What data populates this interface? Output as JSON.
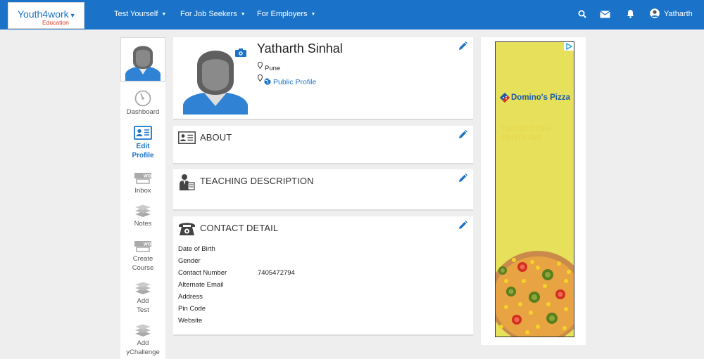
{
  "header": {
    "logo_main": "Youth4work",
    "logo_sub": "Education",
    "nav": [
      {
        "label": "Test Yourself"
      },
      {
        "label": "For Job Seekers"
      },
      {
        "label": "For Employers"
      }
    ],
    "user_name": "Yatharth",
    "icons": [
      "search-icon",
      "mail-icon",
      "bell-icon",
      "user-avatar-icon"
    ]
  },
  "sidebar": {
    "items": [
      {
        "label": "Dashboard",
        "icon": "gauge-icon"
      },
      {
        "label": "Edit Profile",
        "icon": "id-card-icon",
        "active": true
      },
      {
        "label": "Inbox",
        "icon": "inbox-icon"
      },
      {
        "label": "Notes",
        "icon": "books-icon"
      },
      {
        "label": "Create Course",
        "icon": "course-icon"
      },
      {
        "label": "Add Test",
        "icon": "books-icon"
      },
      {
        "label": "Add yChallenge",
        "icon": "books-icon"
      }
    ]
  },
  "profile": {
    "name": "Yatharth Sinhal",
    "location": "Pune",
    "public_profile_label": "Public Profile"
  },
  "sections": {
    "about": {
      "title": "ABOUT"
    },
    "teaching": {
      "title": "TEACHING DESCRIPTION"
    },
    "contact": {
      "title": "CONTACT DETAIL",
      "rows": [
        {
          "label": "Date of Birth",
          "value": ""
        },
        {
          "label": "Gender",
          "value": ""
        },
        {
          "label": "Contact Number",
          "value": "7405472794"
        },
        {
          "label": "Alternate Email",
          "value": ""
        },
        {
          "label": "Address",
          "value": ""
        },
        {
          "label": "Pin Code",
          "value": ""
        },
        {
          "label": "Website",
          "value": ""
        }
      ]
    }
  },
  "ad": {
    "brand": "Domino's Pizza",
    "faint_text": "TWENTY OFF PARTY ON"
  },
  "colors": {
    "brand_blue": "#1a73c9",
    "logo_red": "#d9341f",
    "ad_yellow": "#e6e05a"
  }
}
